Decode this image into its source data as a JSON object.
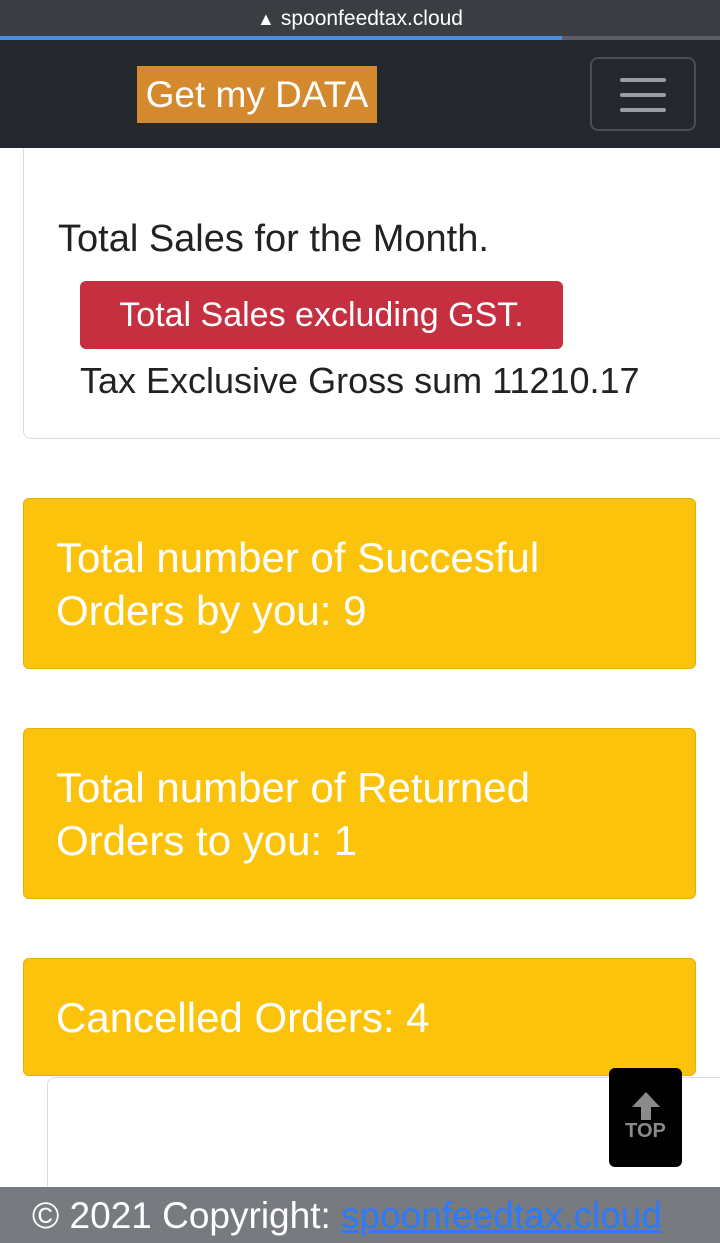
{
  "browser": {
    "url": "spoonfeedtax.cloud",
    "load_progress": 0.78
  },
  "navbar": {
    "brand": "Get my DATA",
    "menu_icon": "hamburger-icon"
  },
  "sales_card": {
    "title": "Total Sales for the Month.",
    "badge": "Total Sales excluding GST.",
    "sum_text": "Tax Exclusive Gross sum 11210.17"
  },
  "cards": [
    {
      "text": "Total number of Succesful Orders by you: 9"
    },
    {
      "text": "Total number of Returned Orders to you: 1"
    },
    {
      "text": "Cancelled Orders: 4"
    }
  ],
  "top_button": {
    "label": "TOP",
    "icon": "arrow-up-icon"
  },
  "footer": {
    "copyright": "© 2021 Copyright: ",
    "link": "spoonfeedtax.cloud"
  },
  "colors": {
    "brand_bg": "#d4892e",
    "badge_bg": "#c62f3f",
    "card_bg": "#fcc30c",
    "navbar_bg": "#24272c",
    "footer_bg": "#777a7f",
    "link": "#2c7bff"
  }
}
